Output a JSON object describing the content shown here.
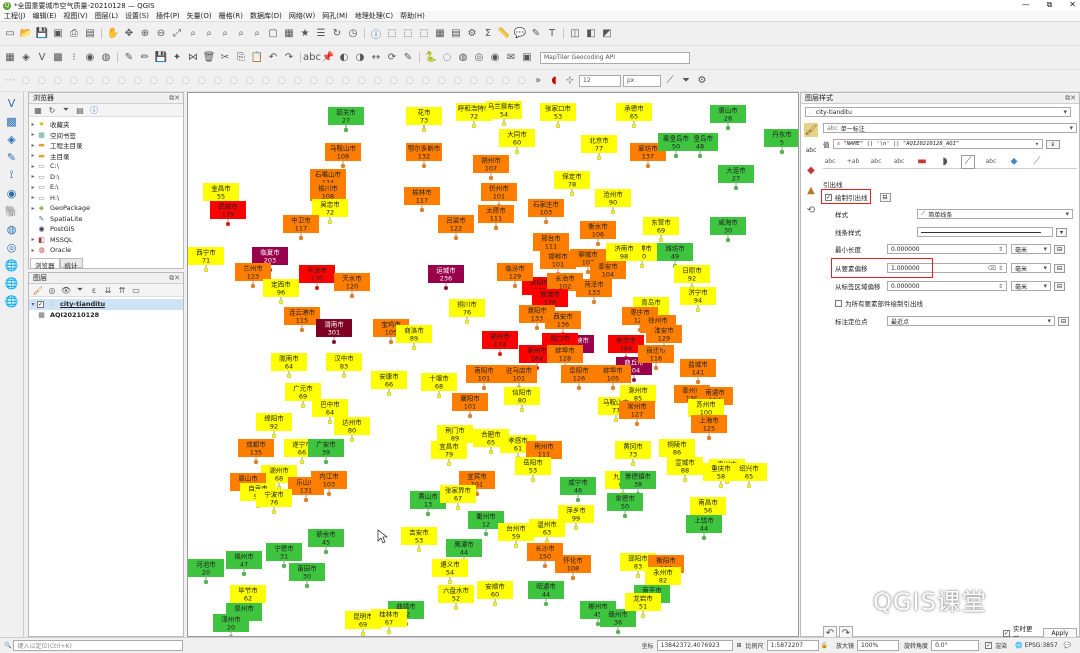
{
  "window": {
    "title": "*全国重要城市空气质量-20210128 — QGIS",
    "controls": [
      "—",
      "⧉",
      "✕"
    ]
  },
  "menu": [
    "工程(J)",
    "编辑(E)",
    "视图(V)",
    "图层(L)",
    "设置(S)",
    "插件(P)",
    "矢量(O)",
    "栅格(R)",
    "数据库(D)",
    "网络(W)",
    "网孔(M)",
    "地理处理(C)",
    "帮助(H)"
  ],
  "toolbar3": {
    "geocoder_placeholder": "MapTiler Geocoding API",
    "font_size": "12",
    "font_unit": "px"
  },
  "browser": {
    "title": "浏览器",
    "items": [
      {
        "label": "收藏夹",
        "icon": "star-icon"
      },
      {
        "label": "空间书签",
        "icon": "bookmark-icon"
      },
      {
        "label": "工程主目录",
        "icon": "folder-icon"
      },
      {
        "label": "主目录",
        "icon": "folder-icon"
      },
      {
        "label": "C:\\",
        "icon": "drive-icon"
      },
      {
        "label": "D:\\",
        "icon": "drive-icon"
      },
      {
        "label": "E:\\",
        "icon": "drive-icon"
      },
      {
        "label": "H:\\",
        "icon": "drive-icon"
      },
      {
        "label": "GeoPackage",
        "icon": "geopackage-icon"
      },
      {
        "label": "SpatiaLite",
        "icon": "spatialite-icon"
      },
      {
        "label": "PostGIS",
        "icon": "postgis-icon"
      },
      {
        "label": "MSSQL",
        "icon": "mssql-icon"
      },
      {
        "label": "Oracle",
        "icon": "oracle-icon"
      }
    ],
    "tabs": [
      "浏览器",
      "统计"
    ]
  },
  "layers": {
    "title": "图层",
    "items": [
      {
        "label": "city-tianditu",
        "checked": true
      },
      {
        "label": "AQI20210128",
        "checked": false
      }
    ]
  },
  "style_panel": {
    "title": "图层样式",
    "layer": "city-tianditu",
    "mode": "单一标注",
    "value_label": "值",
    "value_expr": "\"NAME\"  ||  '\\n'  ||  \"AQI20210128_AQI\"",
    "section": "引出线",
    "draw_callouts": "绘制引出线",
    "style_label": "样式",
    "style_value": "简单线条",
    "line_style_label": "线条样式",
    "min_length_label": "最小长度",
    "min_length": "0.000000",
    "offset_from_feature_label": "从要素偏移",
    "offset_from_feature": "1.000000",
    "offset_from_label_label": "从标签区域偏移",
    "offset_from_label": "0.000000",
    "unit": "毫米",
    "all_parts": "为所有要素部件绘制引出线",
    "anchor_label": "标注定位点",
    "anchor_value": "最近点",
    "live_update": "实时更新",
    "apply": "Apply"
  },
  "status": {
    "locator_placeholder": "键入以定位(Ctrl+K)",
    "coord_label": "坐标",
    "coord": "13842372,4076923",
    "scale_label": "比例尺",
    "scale": "1:5872207",
    "magnifier_label": "放大镜",
    "magnifier": "100%",
    "rotation_label": "旋转角度",
    "rotation": "0.0°",
    "render_label": "渲染",
    "crs": "EPSG:3857"
  },
  "watermark": "QGIS课堂",
  "map_labels": [
    {
      "name": "巴彦淖尔市",
      "aqi": "64"
    },
    {
      "name": "包头市",
      "aqi": "77"
    },
    {
      "name": "呼和浩特市",
      "aqi": "72"
    },
    {
      "name": "乌兰察布市",
      "aqi": "54"
    },
    {
      "name": "张家口市",
      "aqi": "53"
    },
    {
      "name": "承德市",
      "aqi": "65"
    },
    {
      "name": "唐山市",
      "aqi": "28"
    },
    {
      "name": "秦皇岛市",
      "aqi": "48"
    },
    {
      "name": "丹东市",
      "aqi": "5"
    },
    {
      "name": "大同市",
      "aqi": "60"
    },
    {
      "name": "马鞍山市",
      "aqi": "108"
    },
    {
      "name": "鄂尔多斯市",
      "aqi": "132"
    },
    {
      "name": "朔州市",
      "aqi": "107"
    },
    {
      "name": "北京市",
      "aqi": "77"
    },
    {
      "name": "廊坊市",
      "aqi": "137"
    },
    {
      "name": "秦皇岛市",
      "aqi": "50"
    },
    {
      "name": "大连市",
      "aqi": "27"
    },
    {
      "name": "石嘴山市",
      "aqi": "124"
    },
    {
      "name": "银川市",
      "aqi": "108"
    },
    {
      "name": "吴忠市",
      "aqi": "72"
    },
    {
      "name": "榆林市",
      "aqi": "117"
    },
    {
      "name": "忻州市",
      "aqi": "101"
    },
    {
      "name": "保定市",
      "aqi": "78"
    },
    {
      "name": "沧州市",
      "aqi": "90"
    },
    {
      "name": "金昌市",
      "aqi": "55"
    },
    {
      "name": "武威市",
      "aqi": "179"
    },
    {
      "name": "中卫市",
      "aqi": "117"
    },
    {
      "name": "太原市",
      "aqi": "111"
    },
    {
      "name": "石家庄市",
      "aqi": "103"
    },
    {
      "name": "吕梁市",
      "aqi": "122"
    },
    {
      "name": "衡水市",
      "aqi": "106"
    },
    {
      "name": "东营市",
      "aqi": "69"
    },
    {
      "name": "威海市",
      "aqi": "30"
    },
    {
      "name": "邢台市",
      "aqi": "111"
    },
    {
      "name": "聊城市",
      "aqi": "107"
    },
    {
      "name": "淄博市",
      "aqi": "60"
    },
    {
      "name": "潍坊市",
      "aqi": "49"
    },
    {
      "name": "邯郸市",
      "aqi": "101"
    },
    {
      "name": "济南市",
      "aqi": "98"
    },
    {
      "name": "泰安市",
      "aqi": "104"
    },
    {
      "name": "西宁市",
      "aqi": "71"
    },
    {
      "name": "临夏市",
      "aqi": "203"
    },
    {
      "name": "兰州市",
      "aqi": "123"
    },
    {
      "name": "定西市",
      "aqi": "96"
    },
    {
      "name": "平凉市",
      "aqi": "170"
    },
    {
      "name": "天水市",
      "aqi": "120"
    },
    {
      "name": "庆阳市",
      "aqi": "165"
    },
    {
      "name": "运城市",
      "aqi": "236"
    },
    {
      "name": "临汾市",
      "aqi": "129"
    },
    {
      "name": "长治市",
      "aqi": "102"
    },
    {
      "name": "晋城市",
      "aqi": "178"
    },
    {
      "name": "濮阳市",
      "aqi": "133"
    },
    {
      "name": "菏泽市",
      "aqi": "133"
    },
    {
      "name": "济宁市",
      "aqi": "94"
    },
    {
      "name": "日照市",
      "aqi": "92"
    },
    {
      "name": "青岛市",
      "aqi": "93"
    },
    {
      "name": "枣庄市",
      "aqi": "122"
    },
    {
      "name": "连云港市",
      "aqi": "115"
    },
    {
      "name": "铜川市",
      "aqi": "76"
    },
    {
      "name": "渭南市",
      "aqi": "301"
    },
    {
      "name": "宝鸡市",
      "aqi": "105"
    },
    {
      "name": "西安市",
      "aqi": "136"
    },
    {
      "name": "三门峡市",
      "aqi": "224"
    },
    {
      "name": "焦作市",
      "aqi": "164"
    },
    {
      "name": "商丘市",
      "aqi": "204"
    },
    {
      "name": "徐州市",
      "aqi": "148"
    },
    {
      "name": "宿迁市",
      "aqi": "116"
    },
    {
      "name": "淮安市",
      "aqi": "129"
    },
    {
      "name": "盐城市",
      "aqi": "141"
    },
    {
      "name": "商洛市",
      "aqi": "89"
    },
    {
      "name": "郑州市",
      "aqi": "174"
    },
    {
      "name": "周口市",
      "aqi": "161"
    },
    {
      "name": "亳州市",
      "aqi": "184"
    },
    {
      "name": "蚌埠市",
      "aqi": "128"
    },
    {
      "name": "陇南市",
      "aqi": "64"
    },
    {
      "name": "汉中市",
      "aqi": "83"
    },
    {
      "name": "安康市",
      "aqi": "66"
    },
    {
      "name": "十堰市",
      "aqi": "68"
    },
    {
      "name": "南阳市",
      "aqi": "101"
    },
    {
      "name": "驻马店市",
      "aqi": "101"
    },
    {
      "name": "阜阳市",
      "aqi": "126"
    },
    {
      "name": "蚌埠市",
      "aqi": "105"
    },
    {
      "name": "广元市",
      "aqi": "69"
    },
    {
      "name": "巴中市",
      "aqi": "64"
    },
    {
      "name": "襄阳市",
      "aqi": "101"
    },
    {
      "name": "信阳市",
      "aqi": "80"
    },
    {
      "name": "滁州市",
      "aqi": "85"
    },
    {
      "name": "泰州市",
      "aqi": "130"
    },
    {
      "name": "南通市",
      "aqi": "124"
    },
    {
      "name": "绵阳市",
      "aqi": "92"
    },
    {
      "name": "达州市",
      "aqi": "80"
    },
    {
      "name": "荆门市",
      "aqi": "89"
    },
    {
      "name": "合肥市",
      "aqi": "65"
    },
    {
      "name": "马鞍山市",
      "aqi": "77"
    },
    {
      "name": "常州市",
      "aqi": "127"
    },
    {
      "name": "苏州市",
      "aqi": "100"
    },
    {
      "name": "上海市",
      "aqi": "125"
    },
    {
      "name": "成都市",
      "aqi": "135"
    },
    {
      "name": "遂宁市",
      "aqi": "66"
    },
    {
      "name": "广安市",
      "aqi": "39"
    },
    {
      "name": "宜昌市",
      "aqi": "79"
    },
    {
      "name": "孝感市",
      "aqi": "61"
    },
    {
      "name": "荆州市",
      "aqi": "111"
    },
    {
      "name": "黄冈市",
      "aqi": "73"
    },
    {
      "name": "铜陵市",
      "aqi": "86"
    },
    {
      "name": "宣城市",
      "aqi": "88"
    },
    {
      "name": "嘉兴市",
      "aqi": "95"
    },
    {
      "name": "湖州市",
      "aqi": "68"
    },
    {
      "name": "眉山市",
      "aqi": "118"
    },
    {
      "name": "自贡市",
      "aqi": "95"
    },
    {
      "name": "乐山市",
      "aqi": "131"
    },
    {
      "name": "内江市",
      "aqi": "103"
    },
    {
      "name": "重庆市",
      "aqi": "58"
    },
    {
      "name": "绍兴市",
      "aqi": "65"
    },
    {
      "name": "宁波市",
      "aqi": "76"
    },
    {
      "name": "宜宾市",
      "aqi": "101"
    },
    {
      "name": "岳阳市",
      "aqi": "53"
    },
    {
      "name": "咸宁市",
      "aqi": "46"
    },
    {
      "name": "九江市",
      "aqi": "63"
    },
    {
      "name": "景德镇市",
      "aqi": "38"
    },
    {
      "name": "黄山市",
      "aqi": "13"
    },
    {
      "name": "张家界市",
      "aqi": "67"
    },
    {
      "name": "常德市",
      "aqi": "50"
    },
    {
      "name": "南昌市",
      "aqi": "56"
    },
    {
      "name": "上饶市",
      "aqi": "44"
    },
    {
      "name": "衢州市",
      "aqi": "12"
    },
    {
      "name": "台州市",
      "aqi": "59"
    },
    {
      "name": "温州市",
      "aqi": "63"
    },
    {
      "name": "长沙市",
      "aqi": "150"
    },
    {
      "name": "萍乡市",
      "aqi": "99"
    },
    {
      "name": "新余市",
      "aqi": "45"
    },
    {
      "name": "吉安市",
      "aqi": "53"
    },
    {
      "name": "鹰潭市",
      "aqi": "44"
    },
    {
      "name": "遵义市",
      "aqi": "54"
    },
    {
      "name": "怀化市",
      "aqi": "108"
    },
    {
      "name": "邵阳市",
      "aqi": "83"
    },
    {
      "name": "衡阳市",
      "aqi": "104"
    },
    {
      "name": "永州市",
      "aqi": "82"
    },
    {
      "name": "南平市",
      "aqi": "13"
    },
    {
      "name": "宁德市",
      "aqi": "31"
    },
    {
      "name": "福州市",
      "aqi": "47"
    },
    {
      "name": "莆田市",
      "aqi": "30"
    },
    {
      "name": "毕节市",
      "aqi": "62"
    },
    {
      "name": "六盘水市",
      "aqi": "52"
    },
    {
      "name": "安顺市",
      "aqi": "60"
    },
    {
      "name": "昭通市",
      "aqi": "44"
    },
    {
      "name": "郴州市",
      "aqi": "45"
    },
    {
      "name": "赣州市",
      "aqi": "36"
    },
    {
      "name": "龙岩市",
      "aqi": "51"
    },
    {
      "name": "泉州市",
      "aqi": "33"
    },
    {
      "name": "漳州市",
      "aqi": "20"
    },
    {
      "name": "曲靖市",
      "aqi": "42"
    },
    {
      "name": "昆明市",
      "aqi": "69"
    },
    {
      "name": "桂林市",
      "aqi": "67"
    },
    {
      "name": "河池市",
      "aqi": "20"
    },
    {
      "name": "韶关市",
      "aqi": "27"
    },
    {
      "name": "花市",
      "aqi": "73"
    }
  ]
}
